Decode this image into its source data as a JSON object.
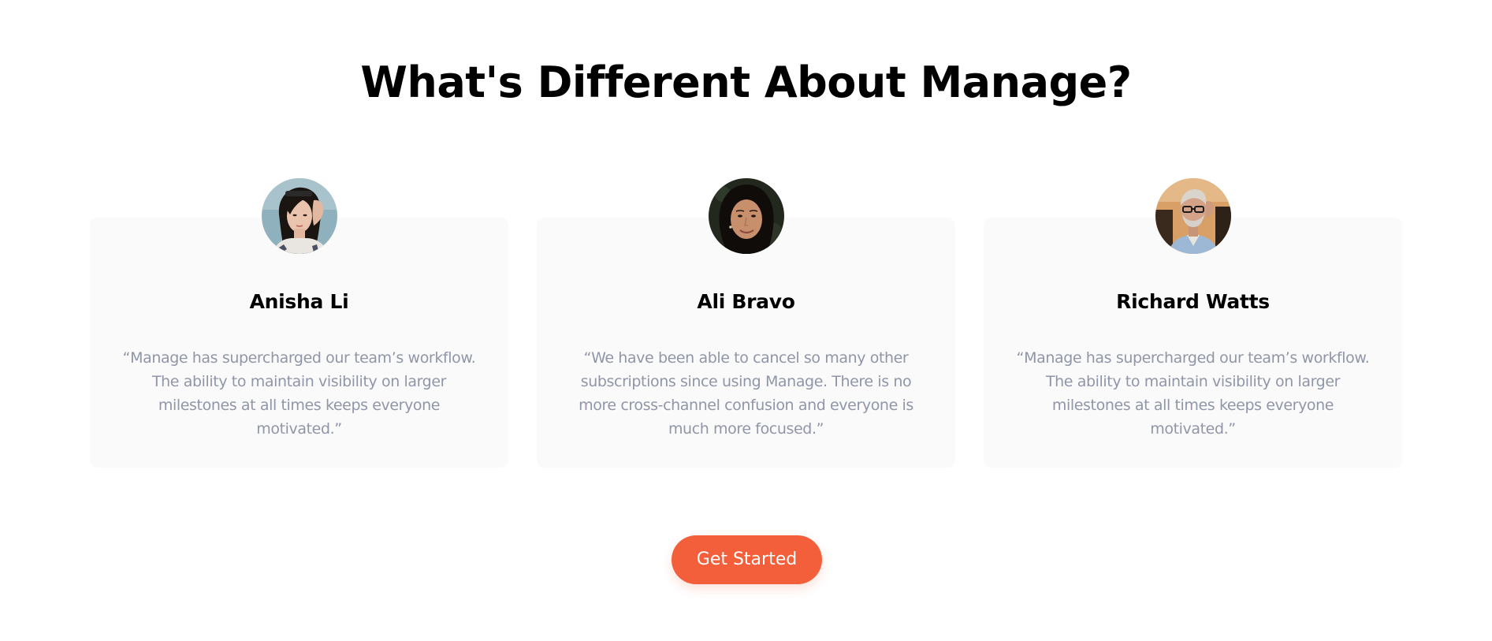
{
  "section": {
    "title": "What's Different About Manage?"
  },
  "testimonials": [
    {
      "name": "Anisha Li",
      "quote": "“Manage has supercharged our team’s workflow. The ability to maintain visibility on larger milestones at all times keeps everyone motivated.”",
      "avatar": "woman-portrait"
    },
    {
      "name": "Ali Bravo",
      "quote": "“We have been able to cancel so many other subscriptions since using Manage. There is no more cross-channel confusion and everyone is much more focused.”",
      "avatar": "woman-portrait"
    },
    {
      "name": "Richard Watts",
      "quote": "“Manage has supercharged our team’s workflow. The ability to maintain visibility on larger milestones at all times keeps everyone motivated.”",
      "avatar": "man-portrait"
    }
  ],
  "cta": {
    "label": "Get Started"
  },
  "colors": {
    "accent": "#f25f3a",
    "card_bg": "#fafafa",
    "quote_text": "#9096a8",
    "heading_text": "#000000"
  }
}
